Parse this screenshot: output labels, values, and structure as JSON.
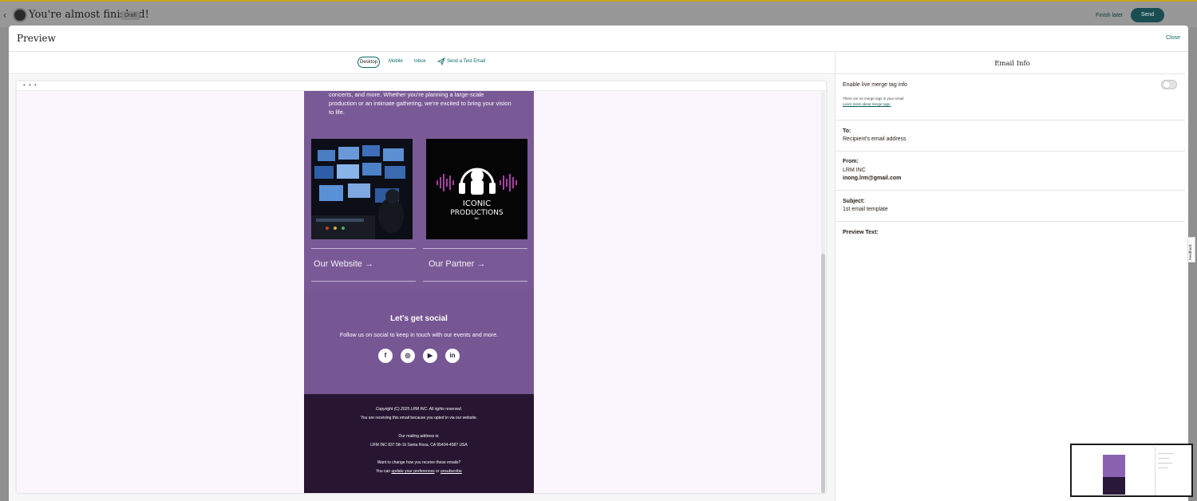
{
  "app": {
    "title": "You're almost finished!",
    "draft_badge": "Draft",
    "finish_later": "Finish later",
    "send": "Send"
  },
  "modal": {
    "title": "Preview",
    "close": "Close",
    "tabs": {
      "desktop": "Desktop",
      "mobile": "Mobile",
      "inbox": "Inbox",
      "send_test": "Send a Test Email"
    },
    "frame_dots": "• • •"
  },
  "email": {
    "intro_text": "concerts, and more. Whether you're planning a large-scale production or an intimate gathering, we're excited to bring your vision to life.",
    "logo_line1": "ICONIC",
    "logo_line2": "PRODUCTIONS",
    "logo_line3": "INC",
    "card_left_link": "Our Website →",
    "card_right_link": "Our Partner →",
    "social_title": "Let's get social",
    "social_sub": "Follow us on social to keep in touch with our events and more.",
    "social_icons": [
      "facebook-icon",
      "instagram-icon",
      "youtube-icon",
      "linkedin-icon"
    ],
    "social_glyphs": [
      "f",
      "◎",
      "▶",
      "in"
    ],
    "footer": {
      "copyright": "Copyright (C) 2025 LRM INC. All rights reserved.",
      "receiving": "You are receiving this email because you opted in via our website.",
      "mailing_label": "Our mailing address is:",
      "address": "LRM INC 837 5th St Santa Rosa, CA 95404-4587 USA",
      "change": "Want to change how you receive these emails?",
      "you_can": "You can ",
      "update_link": "update your preferences",
      "or": " or ",
      "unsubscribe": "unsubscribe"
    }
  },
  "info": {
    "title": "Email Info",
    "merge_label": "Enable live merge tag info",
    "merge_note": "There are no merge tags in your email.",
    "merge_link": "Learn more about merge tags.",
    "to_label": "To:",
    "to_value": "Recipient's email address",
    "from_label": "From:",
    "from_name": "LRM INC",
    "from_email": "inong.lrm@gmail.com",
    "subject_label": "Subject:",
    "subject_value": "1st email template",
    "preview_label": "Preview Text:"
  },
  "feedback": "Feedback",
  "colors": {
    "accent": "#0a6b6b",
    "email_purple": "#7a5a96",
    "footer_purple": "#271532"
  }
}
